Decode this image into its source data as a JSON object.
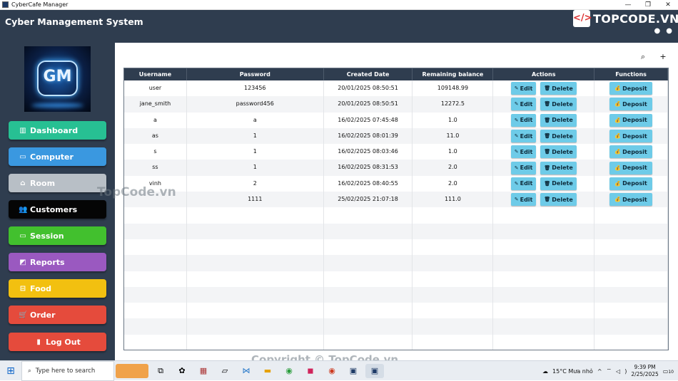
{
  "window": {
    "title": "CyberCafe Manager",
    "controls": [
      "—",
      "❐",
      "✕"
    ]
  },
  "header": {
    "title": "Cyber Management System",
    "brand_logo": "</>",
    "brand": "TOPCODE.VN",
    "icons": [
      "bell-icon",
      "user-icon"
    ]
  },
  "sidebar": {
    "logo_text": "GM",
    "items": [
      {
        "label": "Dashboard",
        "icon": "▥",
        "color": "#27c093"
      },
      {
        "label": "Computer",
        "icon": "▭",
        "color": "#3a98e0"
      },
      {
        "label": "Room",
        "icon": "⌂",
        "color": "#b8bfc6"
      },
      {
        "label": "Customers",
        "icon": "👥",
        "color": "#050505"
      },
      {
        "label": "Session",
        "icon": "▭",
        "color": "#42c02e"
      },
      {
        "label": "Reports",
        "icon": "◩",
        "color": "#9a59c0"
      },
      {
        "label": "Food",
        "icon": "⊟",
        "color": "#f2c010"
      },
      {
        "label": "Order",
        "icon": "🛒",
        "color": "#e54b3c"
      },
      {
        "label": "Log Out",
        "icon": "▮",
        "color": "#e54b3c"
      }
    ]
  },
  "toolbar": {
    "search_icon": "⌕",
    "add_user_icon": "+"
  },
  "table": {
    "columns": [
      "Username",
      "Password",
      "Created Date",
      "Remaining balance",
      "Actions",
      "Functions"
    ],
    "edit_label": "Edit",
    "delete_label": "Delete",
    "deposit_label": "Deposit",
    "edit_icon": "✎",
    "delete_icon": "🗑",
    "deposit_icon": "💰",
    "rows": [
      {
        "username": "user",
        "password": "123456",
        "created": "20/01/2025 08:50:51",
        "balance": "109148.99"
      },
      {
        "username": "jane_smith",
        "password": "password456",
        "created": "20/01/2025 08:50:51",
        "balance": "12272.5"
      },
      {
        "username": "a",
        "password": "a",
        "created": "16/02/2025 07:45:48",
        "balance": "1.0"
      },
      {
        "username": "as",
        "password": "1",
        "created": "16/02/2025 08:01:39",
        "balance": "11.0"
      },
      {
        "username": "s",
        "password": "1",
        "created": "16/02/2025 08:03:46",
        "balance": "1.0"
      },
      {
        "username": "ss",
        "password": "1",
        "created": "16/02/2025 08:31:53",
        "balance": "2.0"
      },
      {
        "username": "vinh",
        "password": "2",
        "created": "16/02/2025 08:40:55",
        "balance": "2.0"
      },
      {
        "username": "",
        "password": "1111",
        "created": "25/02/2025 21:07:18",
        "balance": "111.0"
      }
    ]
  },
  "watermarks": {
    "center": "TopCode.vn",
    "bottom": "Copyright © TopCode.vn"
  },
  "taskbar": {
    "search_placeholder": "Type here to search",
    "weather": "15°C  Mưa nhỏ",
    "time": "9:39 PM",
    "date": "2/25/2025",
    "notifications": "10"
  }
}
